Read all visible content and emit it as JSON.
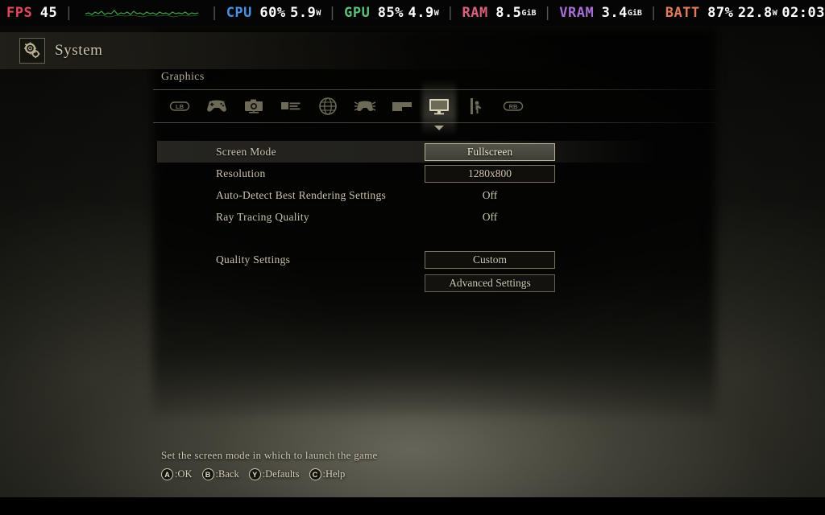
{
  "perf_overlay": {
    "items": [
      {
        "label": "FPS",
        "label_color": "#e0495a",
        "values": [
          "45"
        ],
        "icon": "fps-label"
      },
      {
        "label": "CPU",
        "label_color": "#4a90e2",
        "values": [
          "60%",
          "5.9"
        ],
        "unit": "W",
        "icon": "cpu-label"
      },
      {
        "label": "GPU",
        "label_color": "#5bbf7a",
        "values": [
          "85%",
          "4.9"
        ],
        "unit": "W",
        "icon": "gpu-label"
      },
      {
        "label": "RAM",
        "label_color": "#d8607a",
        "values": [
          "8.5"
        ],
        "unit": "GiB",
        "icon": "ram-label"
      },
      {
        "label": "VRAM",
        "label_color": "#a66fd4",
        "values": [
          "3.4"
        ],
        "unit": "GiB",
        "icon": "vram-label"
      },
      {
        "label": "BATT",
        "label_color": "#e07a5a",
        "values": [
          "87%",
          "22.8",
          "02:03"
        ],
        "unit": "W",
        "icon": "batt-label"
      }
    ],
    "fps_label": "FPS",
    "fps_value": "45",
    "cpu_label": "CPU",
    "cpu_usage": "60%",
    "cpu_watts": "5.9",
    "cpu_watts_unit": "W",
    "gpu_label": "GPU",
    "gpu_usage": "85%",
    "gpu_watts": "4.9",
    "gpu_watts_unit": "W",
    "ram_label": "RAM",
    "ram_value": "8.5",
    "ram_unit": "GiB",
    "vram_label": "VRAM",
    "vram_value": "3.4",
    "vram_unit": "GiB",
    "batt_label": "BATT",
    "batt_percent": "87%",
    "batt_watts": "22.8",
    "batt_watts_unit": "W",
    "batt_time": "02:03",
    "graph_color": "#3fa14a"
  },
  "header": {
    "title": "System",
    "icon": "gears-icon"
  },
  "panel": {
    "section_label": "Graphics",
    "tabs": [
      {
        "name": "bumper-left",
        "icon": "lb-bumper-icon",
        "label": "LB",
        "selected": false
      },
      {
        "name": "controls",
        "icon": "gamepad-icon",
        "label": "Controls",
        "selected": false
      },
      {
        "name": "camera",
        "icon": "camera-icon",
        "label": "Camera",
        "selected": false
      },
      {
        "name": "subtitles",
        "icon": "subtitles-icon",
        "label": "Subtitles",
        "selected": false
      },
      {
        "name": "language",
        "icon": "globe-icon",
        "label": "Language",
        "selected": false
      },
      {
        "name": "gameplay",
        "icon": "gameplay-icon",
        "label": "Gameplay",
        "selected": false
      },
      {
        "name": "interface",
        "icon": "hud-icon",
        "label": "Interface",
        "selected": false
      },
      {
        "name": "graphics",
        "icon": "monitor-icon",
        "label": "Graphics",
        "selected": true
      },
      {
        "name": "accessibility",
        "icon": "accessibility-icon",
        "label": "Accessibility",
        "selected": false
      },
      {
        "name": "bumper-right",
        "icon": "rb-bumper-icon",
        "label": "RB",
        "selected": false
      }
    ],
    "rows": [
      {
        "label": "Screen Mode",
        "value": "Fullscreen",
        "type": "box",
        "selected": true
      },
      {
        "label": "Resolution",
        "value": "1280x800",
        "type": "box",
        "selected": false
      },
      {
        "label": "Auto-Detect Best Rendering Settings",
        "value": "Off",
        "type": "plain",
        "selected": false
      },
      {
        "label": "Ray Tracing Quality",
        "value": "Off",
        "type": "plain",
        "selected": false
      },
      {
        "label": "Quality Settings",
        "value": "Custom",
        "type": "box",
        "selected": false
      },
      {
        "label": "",
        "value": "Advanced Settings",
        "type": "button",
        "selected": false
      }
    ]
  },
  "footer": {
    "description": "Set the screen mode in which to launch the game",
    "prompts": [
      {
        "glyph": "A",
        "label": ":OK"
      },
      {
        "glyph": "B",
        "label": ":Back"
      },
      {
        "glyph": "Y",
        "label": ":Defaults"
      },
      {
        "glyph": "C",
        "label": ":Help"
      }
    ]
  },
  "colors": {
    "accent_text": "#cfc7b0",
    "highlight_fill": "#4a493f",
    "panel_border": "#a8a186",
    "background_dark": "#121210"
  }
}
